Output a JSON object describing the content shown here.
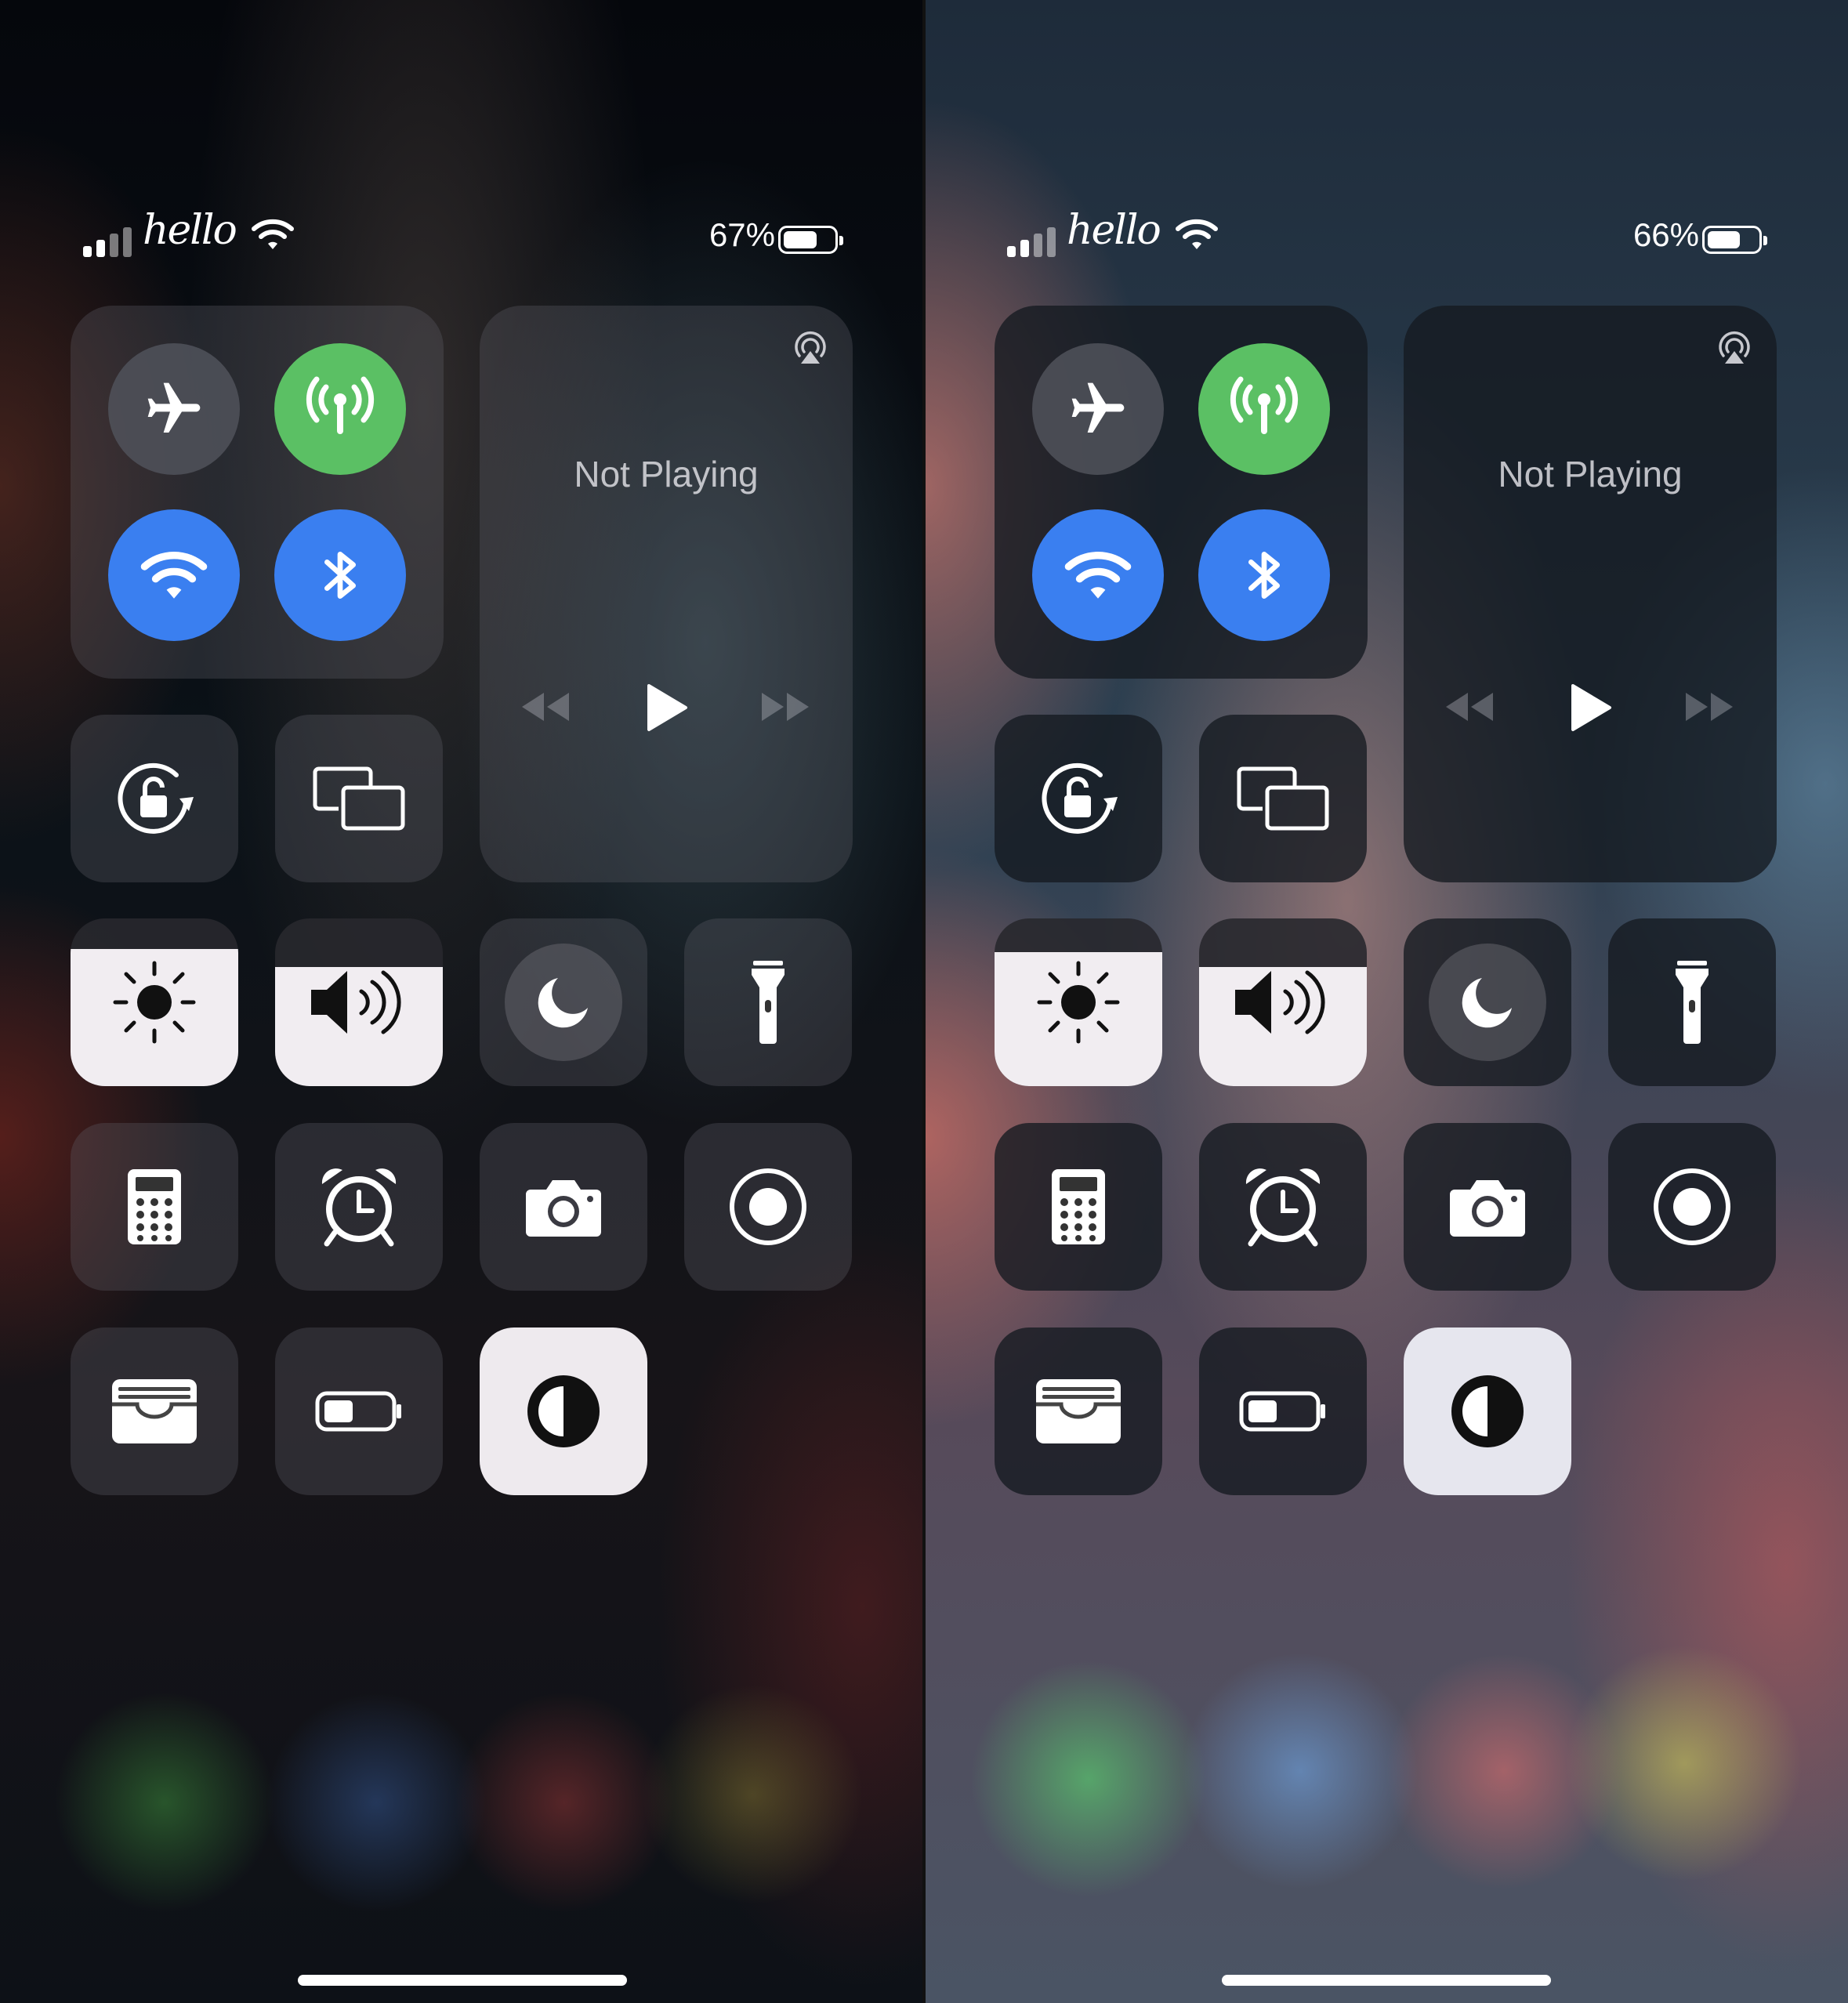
{
  "screens": [
    {
      "id": "left",
      "status_bar": {
        "carrier": "hello",
        "battery_percent": "67%",
        "battery_level": 0.67
      },
      "now_playing": {
        "title": "Not Playing"
      },
      "sliders": {
        "brightness_level": 0.82,
        "volume_level": 0.71
      }
    },
    {
      "id": "right",
      "status_bar": {
        "carrier": "hello",
        "battery_percent": "66%",
        "battery_level": 0.66
      },
      "now_playing": {
        "title": "Not Playing"
      },
      "sliders": {
        "brightness_level": 0.8,
        "volume_level": 0.71
      }
    }
  ],
  "controls": {
    "airplane_mode": {
      "icon": "airplane-icon",
      "state": "off"
    },
    "cellular_data": {
      "icon": "antenna-icon",
      "state": "on",
      "color": "#5bc064"
    },
    "wifi": {
      "icon": "wifi-icon",
      "state": "on",
      "color": "#3a7ff0"
    },
    "bluetooth": {
      "icon": "bluetooth-icon",
      "state": "on",
      "color": "#3a7ff0"
    },
    "orientation_lock": {
      "icon": "rotation-lock-icon"
    },
    "screen_mirroring": {
      "icon": "screen-mirroring-icon"
    },
    "do_not_disturb": {
      "icon": "moon-icon"
    },
    "flashlight": {
      "icon": "flashlight-icon"
    },
    "calculator": {
      "icon": "calculator-icon"
    },
    "alarm": {
      "icon": "alarm-clock-icon"
    },
    "camera": {
      "icon": "camera-icon"
    },
    "screen_recording": {
      "icon": "record-icon"
    },
    "wallet": {
      "icon": "wallet-icon"
    },
    "low_power_mode": {
      "icon": "battery-icon"
    },
    "dark_mode": {
      "icon": "dark-mode-icon",
      "state": "on"
    }
  }
}
